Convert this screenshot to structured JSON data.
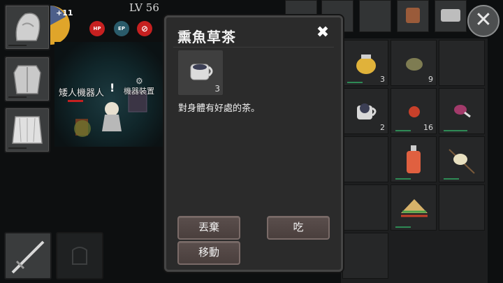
{
  "hud": {
    "level": "LV 56",
    "hp_label": "HP",
    "ep_label": "EP",
    "level_badge": "+11"
  },
  "map": {
    "npc_name": "矮人機器人",
    "device_name": "機器裝置",
    "alert_mark": "!"
  },
  "dialog": {
    "title": "熏魚草茶",
    "close_glyph": "✖",
    "item_count": "3",
    "description": "對身體有好處的茶。",
    "discard_label": "丟棄",
    "eat_label": "吃",
    "move_label": "移動"
  },
  "inventory": {
    "cells": [
      {
        "icon": "honey-jar-icon",
        "count": "3"
      },
      {
        "icon": "seed-pod-icon",
        "count": "9"
      },
      {
        "icon": "",
        "count": ""
      },
      {
        "icon": "tea-cup-icon",
        "count": "2"
      },
      {
        "icon": "tomato-icon",
        "count": "16"
      },
      {
        "icon": "meat-leg-icon",
        "count": ""
      },
      {
        "icon": "",
        "count": ""
      },
      {
        "icon": "potion-bottle-icon",
        "count": ""
      },
      {
        "icon": "meat-skewer-icon",
        "count": ""
      },
      {
        "icon": "",
        "count": ""
      },
      {
        "icon": "sandwich-icon",
        "count": ""
      },
      {
        "icon": "",
        "count": ""
      }
    ]
  },
  "colors": {
    "button_bg": "#4a3f3d",
    "panel_bg": "#2b2b2b",
    "accent_green": "#2e8a55"
  }
}
